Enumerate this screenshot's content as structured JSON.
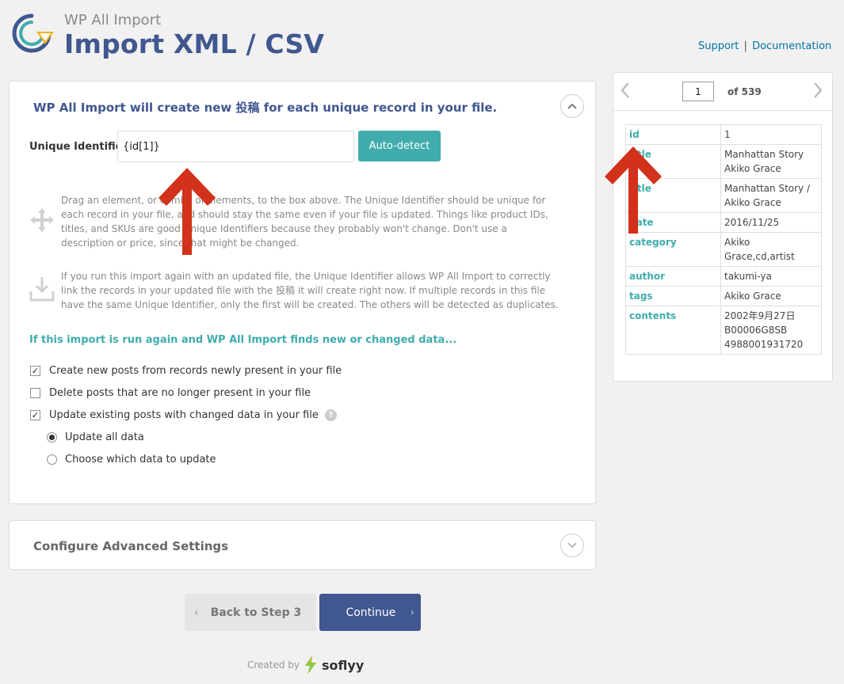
{
  "header": {
    "brand": "WP All Import",
    "title": "Import XML / CSV",
    "support_link": "Support",
    "separator": "|",
    "documentation_link": "Documentation"
  },
  "main": {
    "heading": "WP All Import will create new 投稿 for each unique record in your file.",
    "unique_identifier_label": "Unique Identifier",
    "unique_identifier_value": "{id[1]}",
    "auto_detect_label": "Auto-detect",
    "hint_drag": "Drag an element, or combo of elements, to the box above. The Unique Identifier should be unique for each record in your file, and should stay the same even if your file is updated. Things like product IDs, titles, and SKUs are good Unique Identifiers because they probably won't change. Don't use a description or price, since that might be changed.",
    "hint_update": "If you run this import again with an updated file, the Unique Identifier allows WP All Import to correctly link the records in your updated file with the 投稿 it will create right now. If multiple records in this file have the same Unique Identifier, only the first will be created. The others will be detected as duplicates.",
    "rerun_title": "If this import is run again and WP All Import finds new or changed data...",
    "options": {
      "create_new": "Create new posts from records newly present in your file",
      "delete_missing": "Delete posts that are no longer present in your file",
      "update_existing": "Update existing posts with changed data in your file",
      "update_all": "Update all data",
      "choose_which": "Choose which data to update"
    },
    "help_glyph": "?"
  },
  "advanced": {
    "title": "Configure Advanced Settings"
  },
  "footer": {
    "back_label": "Back to Step 3",
    "continue_label": "Continue",
    "created_by": "Created by",
    "company": "soflyy"
  },
  "record_panel": {
    "current_record": "1",
    "of_label": "of 539",
    "rows": [
      {
        "key": "id",
        "value": "1"
      },
      {
        "key": "title",
        "value": "Manhattan Story Akiko Grace"
      },
      {
        "key": "title",
        "value": "Manhattan Story / Akiko Grace"
      },
      {
        "key": "date",
        "value": "2016/11/25"
      },
      {
        "key": "category",
        "value": "Akiko Grace,cd,artist"
      },
      {
        "key": "author",
        "value": "takumi-ya"
      },
      {
        "key": "tags",
        "value": "Akiko Grace"
      },
      {
        "key": "contents",
        "value": "2002年9月27日 B00006G8SB 4988001931720"
      }
    ]
  },
  "colors": {
    "brand_blue": "#40578f",
    "teal": "#40acad",
    "arrow_red": "#d2311b"
  }
}
